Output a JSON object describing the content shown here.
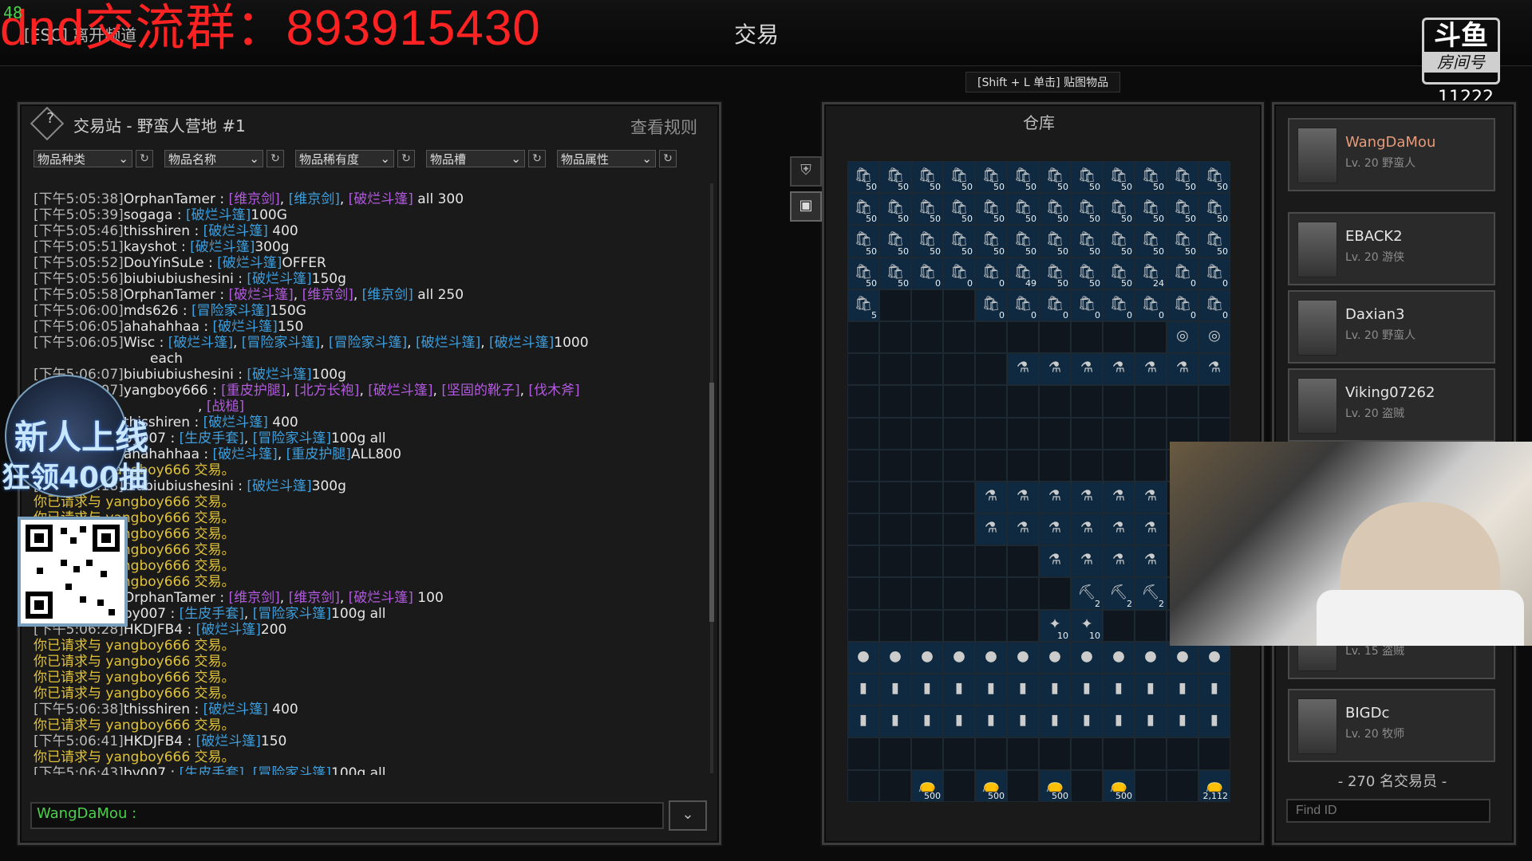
{
  "overlay": {
    "fps": "48",
    "group_text": "dnd交流群：893915430"
  },
  "topbar": {
    "esc_label": "[ESC] 离开频道",
    "title": "交易"
  },
  "stream": {
    "logo_main": "斗鱼",
    "logo_sub": "房间号",
    "room_number": "11222"
  },
  "trade_station": {
    "title": "交易站 - 野蛮人营地 #1",
    "rules_button": "查看规则",
    "filters": [
      {
        "label": "物品种类"
      },
      {
        "label": "物品名称"
      },
      {
        "label": "物品稀有度"
      },
      {
        "label": "物品槽"
      },
      {
        "label": "物品属性"
      }
    ],
    "chat": [
      {
        "ts": "[下午5:05:38]",
        "name": "OrphanTamer",
        "parts": [
          [
            "p",
            "[维京剑]"
          ],
          [
            "t",
            ", "
          ],
          [
            "b",
            "[维京剑]"
          ],
          [
            "t",
            ", "
          ],
          [
            "p",
            "[破烂斗篷]"
          ],
          [
            "t",
            " all 300"
          ]
        ]
      },
      {
        "ts": "[下午5:05:39]",
        "name": "sogaga",
        "parts": [
          [
            "b",
            "[破烂斗篷]"
          ],
          [
            "t",
            "100G"
          ]
        ]
      },
      {
        "ts": "[下午5:05:46]",
        "name": "thisshiren",
        "parts": [
          [
            "b",
            "[破烂斗篷]"
          ],
          [
            "t",
            " 400"
          ]
        ]
      },
      {
        "ts": "[下午5:05:51]",
        "name": "kayshot",
        "parts": [
          [
            "b",
            "[破烂斗篷]"
          ],
          [
            "t",
            "300g"
          ]
        ]
      },
      {
        "ts": "[下午5:05:52]",
        "name": "DouYinSuLe",
        "parts": [
          [
            "b",
            "[破烂斗篷]"
          ],
          [
            "t",
            "OFFER"
          ]
        ]
      },
      {
        "ts": "[下午5:05:56]",
        "name": "biubiubiushesini",
        "parts": [
          [
            "b",
            "[破烂斗篷]"
          ],
          [
            "t",
            "150g"
          ]
        ]
      },
      {
        "ts": "[下午5:05:58]",
        "name": "OrphanTamer",
        "parts": [
          [
            "p",
            "[破烂斗篷]"
          ],
          [
            "t",
            ", "
          ],
          [
            "p",
            "[维京剑]"
          ],
          [
            "t",
            ", "
          ],
          [
            "b",
            "[维京剑]"
          ],
          [
            "t",
            " all 250"
          ]
        ]
      },
      {
        "ts": "[下午5:06:00]",
        "name": "mds626",
        "parts": [
          [
            "b",
            "[冒险家斗篷]"
          ],
          [
            "t",
            "150G"
          ]
        ]
      },
      {
        "ts": "[下午5:06:05]",
        "name": "ahahahhaa",
        "parts": [
          [
            "b",
            "[破烂斗篷]"
          ],
          [
            "t",
            "150"
          ]
        ]
      },
      {
        "ts": "[下午5:06:05]",
        "name": "Wisc",
        "parts": [
          [
            "b",
            "[破烂斗篷]"
          ],
          [
            "t",
            ", "
          ],
          [
            "b",
            "[冒险家斗篷]"
          ],
          [
            "t",
            ", "
          ],
          [
            "b",
            "[冒险家斗篷]"
          ],
          [
            "t",
            ", "
          ],
          [
            "b",
            "[破烂斗篷]"
          ],
          [
            "t",
            ", "
          ],
          [
            "b",
            "[破烂斗篷]"
          ],
          [
            "t",
            "1000"
          ]
        ]
      },
      {
        "ts": "",
        "name": "",
        "parts": [
          [
            "t",
            "each"
          ]
        ],
        "indent": true
      },
      {
        "ts": "[下午5:06:07]",
        "name": "biubiubiushesini",
        "parts": [
          [
            "b",
            "[破烂斗篷]"
          ],
          [
            "t",
            "100g"
          ]
        ]
      },
      {
        "ts": "[下午5:06:07]",
        "name": "yangboy666",
        "parts": [
          [
            "p",
            "[重皮护腿]"
          ],
          [
            "t",
            ", "
          ],
          [
            "p",
            "[北方长袍]"
          ],
          [
            "t",
            ", "
          ],
          [
            "p",
            "[破烂斗篷]"
          ],
          [
            "t",
            ", "
          ],
          [
            "p",
            "[坚固的靴子]"
          ],
          [
            "t",
            ", "
          ],
          [
            "p",
            "[伐木斧]"
          ]
        ]
      },
      {
        "ts": "",
        "name": "",
        "parts": [
          [
            "t",
            ", "
          ],
          [
            "p",
            "[战槌]"
          ]
        ],
        "indent": true
      },
      {
        "ts": "[下午5:06:13]",
        "name": "thisshiren",
        "parts": [
          [
            "b",
            "[破烂斗篷]"
          ],
          [
            "t",
            " 400"
          ]
        ]
      },
      {
        "ts": "[下午5:06:14]",
        "name": "by007",
        "parts": [
          [
            "b",
            "[生皮手套]"
          ],
          [
            "t",
            ", "
          ],
          [
            "b",
            "[冒险家斗篷]"
          ],
          [
            "t",
            "100g all"
          ]
        ]
      },
      {
        "ts": "[下午5:06:15]",
        "name": "ahahahhaa",
        "parts": [
          [
            "b",
            "[破烂斗篷]"
          ],
          [
            "t",
            ", "
          ],
          [
            "b",
            "[重皮护腿]"
          ],
          [
            "t",
            "ALL800"
          ]
        ]
      },
      {
        "ts": "",
        "name": "",
        "sys": "你已请求与 yangboy666 交易。"
      },
      {
        "ts": "[下午5:06:18]",
        "name": "biubiubiushesini",
        "parts": [
          [
            "b",
            "[破烂斗篷]"
          ],
          [
            "t",
            "300g"
          ]
        ]
      },
      {
        "ts": "",
        "name": "",
        "sys": "你已请求与 yangboy666 交易。"
      },
      {
        "ts": "",
        "name": "",
        "sys": "你已请求与 yangboy666 交易。"
      },
      {
        "ts": "",
        "name": "",
        "sys": "你已请求与 yangboy666 交易。"
      },
      {
        "ts": "",
        "name": "",
        "sys": "你已请求与 yangboy666 交易。"
      },
      {
        "ts": "",
        "name": "",
        "sys": "你已请求与 yangboy666 交易。"
      },
      {
        "ts": "",
        "name": "",
        "sys": "你已请求与 yangboy666 交易。"
      },
      {
        "ts": "[下午5:06:25]",
        "name": "OrphanTamer",
        "parts": [
          [
            "p",
            "[维京剑]"
          ],
          [
            "t",
            ", "
          ],
          [
            "p",
            "[维京剑]"
          ],
          [
            "t",
            ", "
          ],
          [
            "p",
            "[破烂斗篷]"
          ],
          [
            "t",
            " 100"
          ]
        ]
      },
      {
        "ts": "[下午5:06:27]",
        "name": "by007",
        "parts": [
          [
            "b",
            "[生皮手套]"
          ],
          [
            "t",
            ", "
          ],
          [
            "b",
            "[冒险家斗篷]"
          ],
          [
            "t",
            "100g all"
          ]
        ]
      },
      {
        "ts": "[下午5:06:28]",
        "name": "HKDJFB4",
        "parts": [
          [
            "b",
            "[破烂斗篷]"
          ],
          [
            "t",
            "200"
          ]
        ]
      },
      {
        "ts": "",
        "name": "",
        "sys": "你已请求与 yangboy666 交易。"
      },
      {
        "ts": "",
        "name": "",
        "sys": "你已请求与 yangboy666 交易。"
      },
      {
        "ts": "",
        "name": "",
        "sys": "你已请求与 yangboy666 交易。"
      },
      {
        "ts": "",
        "name": "",
        "sys": "你已请求与 yangboy666 交易。"
      },
      {
        "ts": "[下午5:06:38]",
        "name": "thisshiren",
        "parts": [
          [
            "b",
            "[破烂斗篷]"
          ],
          [
            "t",
            " 400"
          ]
        ]
      },
      {
        "ts": "",
        "name": "",
        "sys": "你已请求与 yangboy666 交易。"
      },
      {
        "ts": "[下午5:06:41]",
        "name": "HKDJFB4",
        "parts": [
          [
            "b",
            "[破烂斗篷]"
          ],
          [
            "t",
            "150"
          ]
        ]
      },
      {
        "ts": "",
        "name": "",
        "sys": "你已请求与 yangboy666 交易。"
      },
      {
        "ts": "[下午5:06:43]",
        "name": "by007",
        "parts": [
          [
            "b",
            "[生皮手套]"
          ],
          [
            "t",
            ", "
          ],
          [
            "b",
            "[冒险家斗篷]"
          ],
          [
            "t",
            "100g all"
          ]
        ]
      }
    ],
    "input_label": "WangDaMou :",
    "input_value": ""
  },
  "promo": {
    "line1": "新人上线",
    "line2": "狂领400抽"
  },
  "stash": {
    "hint": "[Shift + L 单击] 贴图物品",
    "title": "仓库",
    "rows": [
      [
        "50",
        "50",
        "50",
        "50",
        "50",
        "50",
        "50",
        "50",
        "50",
        "50",
        "50",
        "50"
      ],
      [
        "50",
        "50",
        "50",
        "50",
        "50",
        "50",
        "50",
        "50",
        "50",
        "50",
        "50",
        "50"
      ],
      [
        "50",
        "50",
        "50",
        "50",
        "50",
        "50",
        "50",
        "50",
        "50",
        "50",
        "50",
        "50"
      ],
      [
        "50",
        "50",
        "0",
        "0",
        "0",
        "49",
        "50",
        "50",
        "50",
        "24",
        "0",
        "0"
      ],
      [
        "5",
        "",
        "",
        "",
        "0",
        "0",
        "0",
        "0",
        "0",
        "0",
        "0",
        "0"
      ],
      [
        "",
        "",
        "",
        "",
        "",
        "",
        "",
        "",
        "",
        "",
        "",
        ""
      ],
      [
        "",
        "",
        "",
        "",
        "",
        "",
        "",
        "",
        "",
        "",
        "",
        ""
      ],
      [
        "",
        "",
        "",
        "",
        "",
        "",
        "",
        "",
        "",
        "",
        "",
        ""
      ],
      [
        "",
        "",
        "",
        "",
        "",
        "",
        "",
        "",
        "",
        "",
        "",
        ""
      ],
      [
        "",
        "",
        "",
        "",
        "",
        "",
        "",
        "",
        "",
        "",
        "",
        ""
      ],
      [
        "",
        "",
        "",
        "",
        "",
        "",
        "",
        "",
        "",
        "",
        "",
        ""
      ],
      [
        "",
        "",
        "",
        "",
        "",
        "",
        "",
        "",
        "",
        "",
        "",
        ""
      ],
      [
        "",
        "",
        "",
        "",
        "",
        "",
        "",
        "",
        "",
        "",
        "",
        ""
      ],
      [
        "",
        "",
        "",
        "",
        "",
        "",
        "",
        "2",
        "2",
        "2",
        "",
        ""
      ],
      [
        "",
        "",
        "",
        "",
        "",
        "",
        "10",
        "10",
        "",
        "",
        "",
        ""
      ],
      [
        "",
        "",
        "",
        "",
        "",
        "",
        "",
        "",
        "",
        "",
        "",
        ""
      ],
      [
        "",
        "",
        "",
        "",
        "",
        "",
        "",
        "",
        "",
        "",
        "",
        ""
      ],
      [
        "",
        "",
        "",
        "",
        "",
        "",
        "",
        "",
        "",
        "",
        "",
        ""
      ],
      [
        "",
        "",
        "",
        "",
        "",
        "",
        "",
        "",
        "",
        "",
        "",
        ""
      ],
      [
        "",
        "",
        "500",
        "",
        "500",
        "",
        "500",
        "",
        "500",
        "",
        "",
        "2,112"
      ]
    ]
  },
  "traders": {
    "list": [
      {
        "name": "WangDaMou",
        "level": "Lv. 20 野蛮人",
        "me": true
      },
      {
        "name": "EBACK2",
        "level": "Lv. 20 游侠"
      },
      {
        "name": "Daxian3",
        "level": "Lv. 20 野蛮人"
      },
      {
        "name": "Viking07262",
        "level": "Lv. 20 盗贼"
      },
      {
        "name": "",
        "level": "Lv. 15 盗贼"
      },
      {
        "name": "BIGDc",
        "level": "Lv. 20 牧师"
      }
    ],
    "count_text": "- 270 名交易员 -",
    "find_placeholder": "Find ID"
  }
}
